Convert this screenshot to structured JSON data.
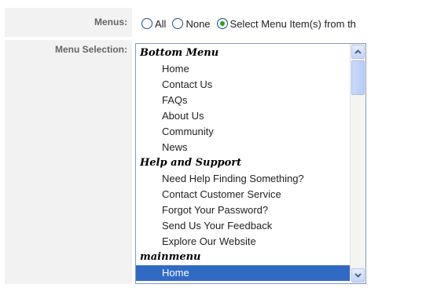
{
  "form": {
    "menus_label": "Menus:",
    "menu_selection_label": "Menu Selection:",
    "radio_options": [
      {
        "label": "All",
        "checked": false
      },
      {
        "label": "None",
        "checked": false
      },
      {
        "label": "Select Menu Item(s) from th",
        "checked": true
      }
    ]
  },
  "listbox": {
    "groups": [
      {
        "name": "Bottom Menu",
        "items": [
          "Home",
          "Contact Us",
          "FAQs",
          "About Us",
          "Community",
          "News"
        ]
      },
      {
        "name": "Help and Support",
        "items": [
          "Need Help Finding Something?",
          "Contact Customer Service",
          "Forgot Your Password?",
          "Send Us Your Feedback",
          "Explore Our Website"
        ]
      },
      {
        "name": "mainmenu",
        "items": [
          "Home"
        ]
      }
    ],
    "selected": "mainmenu/Home"
  },
  "colors": {
    "selection": "#316ac5",
    "radio_checked": "#21a121",
    "label_bg": "#f2f2f2"
  }
}
